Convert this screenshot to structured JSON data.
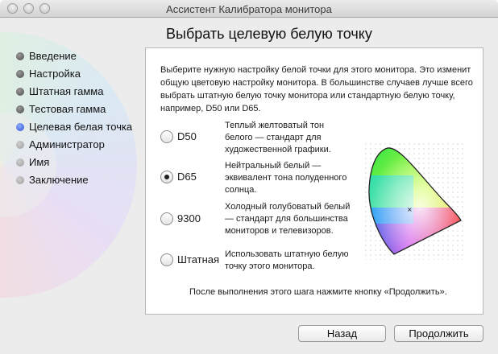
{
  "window": {
    "title": "Ассистент Калибратора монитора"
  },
  "heading": "Выбрать целевую белую точку",
  "steps": [
    {
      "label": "Введение",
      "state": "done"
    },
    {
      "label": "Настройка",
      "state": "done"
    },
    {
      "label": "Штатная гамма",
      "state": "done"
    },
    {
      "label": "Тестовая гамма",
      "state": "done"
    },
    {
      "label": "Целевая белая точка",
      "state": "active"
    },
    {
      "label": "Администратор",
      "state": "todo"
    },
    {
      "label": "Имя",
      "state": "todo"
    },
    {
      "label": "Заключение",
      "state": "todo"
    }
  ],
  "intro": "Выберите нужную настройку белой точки для этого монитора. Это изменит общую цветовую настройку монитора. В большинстве случаев лучше всего выбрать штатную белую точку монитора или стандартную белую точку, например, D50 или D65.",
  "options": [
    {
      "label": "D50",
      "checked": false,
      "description": "Теплый желтоватый тон белого — стандарт для художественной графики."
    },
    {
      "label": "D65",
      "checked": true,
      "description": "Нейтральный белый — эквивалент тона полуденного солнца."
    },
    {
      "label": "9300",
      "checked": false,
      "description": "Холодный голубоватый белый — стандарт для большинства мониторов и телевизоров."
    },
    {
      "label": "Штатная",
      "checked": false,
      "description": "Использовать штатную белую точку этого монитора."
    }
  ],
  "footer_note": "После выполнения этого шага нажмите кнопку «Продолжить».",
  "buttons": {
    "back": "Назад",
    "continue": "Продолжить"
  },
  "colors": {
    "active_step": "#2c4fcf",
    "panel_bg": "#ffffff",
    "window_bg": "#ececec"
  }
}
